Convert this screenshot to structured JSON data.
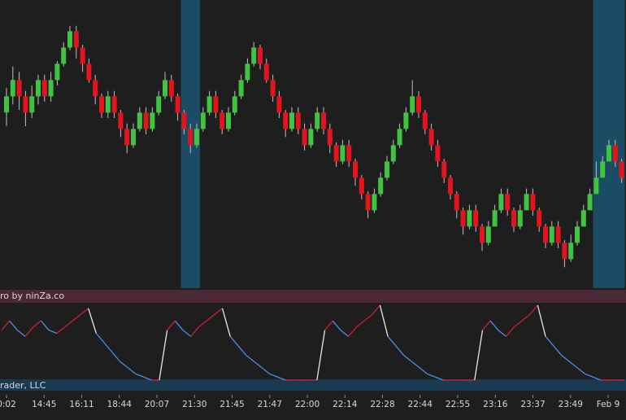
{
  "colors": {
    "background": "#1e1e1e",
    "bull": "#3ec43e",
    "bear": "#e3141b",
    "wick": "#bfbfbf",
    "highlight": "#1a4d63",
    "oscillator_header": "#4a2836",
    "oscillator_footer": "#1a3a52",
    "osc_blue": "#4a8fe8",
    "osc_red": "#d21e32",
    "osc_white": "#e8e8e8",
    "text": "#d8d8d8"
  },
  "price_panel": {
    "highlight_bars": [
      {
        "from_index": 28,
        "to_index": 30
      },
      {
        "from_index": 93,
        "to_index": 97
      }
    ]
  },
  "oscillator_panel": {
    "header_label": "ro by ninZa.co",
    "footer_label": "rader, LLC"
  },
  "chart_data": {
    "type": "candlestick",
    "bar_type": "renko",
    "candles": [
      {
        "o": 135,
        "c": 141,
        "h": 144,
        "l": 130
      },
      {
        "o": 141,
        "c": 147,
        "h": 152,
        "l": 138
      },
      {
        "o": 147,
        "c": 141,
        "h": 150,
        "l": 136
      },
      {
        "o": 141,
        "c": 135,
        "h": 143,
        "l": 130
      },
      {
        "o": 135,
        "c": 141,
        "h": 145,
        "l": 133
      },
      {
        "o": 141,
        "c": 147,
        "h": 149,
        "l": 138
      },
      {
        "o": 147,
        "c": 141,
        "h": 149,
        "l": 139
      },
      {
        "o": 141,
        "c": 147,
        "h": 150,
        "l": 139
      },
      {
        "o": 147,
        "c": 153,
        "h": 154,
        "l": 145
      },
      {
        "o": 153,
        "c": 159,
        "h": 161,
        "l": 152
      },
      {
        "o": 159,
        "c": 165,
        "h": 167,
        "l": 158
      },
      {
        "o": 165,
        "c": 159,
        "h": 167,
        "l": 155
      },
      {
        "o": 159,
        "c": 153,
        "h": 160,
        "l": 150
      },
      {
        "o": 153,
        "c": 147,
        "h": 155,
        "l": 146
      },
      {
        "o": 147,
        "c": 141,
        "h": 149,
        "l": 138
      },
      {
        "o": 141,
        "c": 135,
        "h": 142,
        "l": 133
      },
      {
        "o": 135,
        "c": 141,
        "h": 143,
        "l": 133
      },
      {
        "o": 141,
        "c": 135,
        "h": 143,
        "l": 133
      },
      {
        "o": 135,
        "c": 129,
        "h": 136,
        "l": 126
      },
      {
        "o": 129,
        "c": 123,
        "h": 131,
        "l": 120
      },
      {
        "o": 123,
        "c": 129,
        "h": 131,
        "l": 122
      },
      {
        "o": 129,
        "c": 135,
        "h": 137,
        "l": 128
      },
      {
        "o": 135,
        "c": 129,
        "h": 137,
        "l": 127
      },
      {
        "o": 129,
        "c": 135,
        "h": 137,
        "l": 128
      },
      {
        "o": 135,
        "c": 141,
        "h": 143,
        "l": 134
      },
      {
        "o": 141,
        "c": 147,
        "h": 150,
        "l": 140
      },
      {
        "o": 147,
        "c": 141,
        "h": 149,
        "l": 139
      },
      {
        "o": 141,
        "c": 135,
        "h": 142,
        "l": 132
      },
      {
        "o": 135,
        "c": 129,
        "h": 136,
        "l": 127
      },
      {
        "o": 129,
        "c": 123,
        "h": 131,
        "l": 120
      },
      {
        "o": 123,
        "c": 129,
        "h": 131,
        "l": 122
      },
      {
        "o": 129,
        "c": 135,
        "h": 137,
        "l": 128
      },
      {
        "o": 135,
        "c": 141,
        "h": 143,
        "l": 134
      },
      {
        "o": 141,
        "c": 135,
        "h": 143,
        "l": 133
      },
      {
        "o": 135,
        "c": 129,
        "h": 136,
        "l": 127
      },
      {
        "o": 129,
        "c": 135,
        "h": 137,
        "l": 128
      },
      {
        "o": 135,
        "c": 141,
        "h": 143,
        "l": 134
      },
      {
        "o": 141,
        "c": 147,
        "h": 149,
        "l": 140
      },
      {
        "o": 147,
        "c": 153,
        "h": 155,
        "l": 146
      },
      {
        "o": 153,
        "c": 159,
        "h": 161,
        "l": 152
      },
      {
        "o": 159,
        "c": 153,
        "h": 160,
        "l": 151
      },
      {
        "o": 153,
        "c": 147,
        "h": 155,
        "l": 146
      },
      {
        "o": 147,
        "c": 141,
        "h": 149,
        "l": 139
      },
      {
        "o": 141,
        "c": 135,
        "h": 143,
        "l": 133
      },
      {
        "o": 135,
        "c": 129,
        "h": 136,
        "l": 126
      },
      {
        "o": 129,
        "c": 135,
        "h": 137,
        "l": 128
      },
      {
        "o": 135,
        "c": 129,
        "h": 137,
        "l": 127
      },
      {
        "o": 129,
        "c": 123,
        "h": 131,
        "l": 121
      },
      {
        "o": 123,
        "c": 129,
        "h": 131,
        "l": 122
      },
      {
        "o": 129,
        "c": 135,
        "h": 137,
        "l": 128
      },
      {
        "o": 135,
        "c": 129,
        "h": 137,
        "l": 127
      },
      {
        "o": 129,
        "c": 123,
        "h": 131,
        "l": 120
      },
      {
        "o": 123,
        "c": 117,
        "h": 124,
        "l": 115
      },
      {
        "o": 117,
        "c": 123,
        "h": 125,
        "l": 116
      },
      {
        "o": 123,
        "c": 117,
        "h": 125,
        "l": 115
      },
      {
        "o": 117,
        "c": 111,
        "h": 118,
        "l": 108
      },
      {
        "o": 111,
        "c": 105,
        "h": 112,
        "l": 103
      },
      {
        "o": 105,
        "c": 99,
        "h": 106,
        "l": 96
      },
      {
        "o": 99,
        "c": 105,
        "h": 107,
        "l": 98
      },
      {
        "o": 105,
        "c": 111,
        "h": 113,
        "l": 104
      },
      {
        "o": 111,
        "c": 117,
        "h": 119,
        "l": 110
      },
      {
        "o": 117,
        "c": 123,
        "h": 125,
        "l": 116
      },
      {
        "o": 123,
        "c": 129,
        "h": 131,
        "l": 122
      },
      {
        "o": 129,
        "c": 135,
        "h": 137,
        "l": 128
      },
      {
        "o": 135,
        "c": 141,
        "h": 147,
        "l": 134
      },
      {
        "o": 141,
        "c": 135,
        "h": 143,
        "l": 133
      },
      {
        "o": 135,
        "c": 129,
        "h": 136,
        "l": 127
      },
      {
        "o": 129,
        "c": 123,
        "h": 131,
        "l": 121
      },
      {
        "o": 123,
        "c": 117,
        "h": 125,
        "l": 115
      },
      {
        "o": 117,
        "c": 111,
        "h": 118,
        "l": 109
      },
      {
        "o": 111,
        "c": 105,
        "h": 112,
        "l": 103
      },
      {
        "o": 105,
        "c": 99,
        "h": 106,
        "l": 96
      },
      {
        "o": 99,
        "c": 93,
        "h": 100,
        "l": 90
      },
      {
        "o": 93,
        "c": 99,
        "h": 101,
        "l": 92
      },
      {
        "o": 99,
        "c": 93,
        "h": 101,
        "l": 91
      },
      {
        "o": 93,
        "c": 87,
        "h": 94,
        "l": 84
      },
      {
        "o": 87,
        "c": 93,
        "h": 95,
        "l": 86
      },
      {
        "o": 93,
        "c": 99,
        "h": 101,
        "l": 98
      },
      {
        "o": 99,
        "c": 105,
        "h": 107,
        "l": 98
      },
      {
        "o": 105,
        "c": 99,
        "h": 107,
        "l": 97
      },
      {
        "o": 99,
        "c": 93,
        "h": 100,
        "l": 91
      },
      {
        "o": 93,
        "c": 99,
        "h": 101,
        "l": 92
      },
      {
        "o": 99,
        "c": 105,
        "h": 107,
        "l": 104
      },
      {
        "o": 105,
        "c": 99,
        "h": 107,
        "l": 97
      },
      {
        "o": 99,
        "c": 93,
        "h": 100,
        "l": 91
      },
      {
        "o": 93,
        "c": 87,
        "h": 94,
        "l": 85
      },
      {
        "o": 87,
        "c": 93,
        "h": 95,
        "l": 86
      },
      {
        "o": 93,
        "c": 87,
        "h": 95,
        "l": 85
      },
      {
        "o": 87,
        "c": 81,
        "h": 88,
        "l": 78
      },
      {
        "o": 81,
        "c": 87,
        "h": 90,
        "l": 80
      },
      {
        "o": 87,
        "c": 93,
        "h": 95,
        "l": 86
      },
      {
        "o": 93,
        "c": 99,
        "h": 101,
        "l": 98
      },
      {
        "o": 99,
        "c": 105,
        "h": 107,
        "l": 104
      },
      {
        "o": 105,
        "c": 111,
        "h": 117,
        "l": 110
      },
      {
        "o": 111,
        "c": 117,
        "h": 119,
        "l": 116
      },
      {
        "o": 117,
        "c": 123,
        "h": 125,
        "l": 122
      },
      {
        "o": 123,
        "c": 117,
        "h": 125,
        "l": 115
      },
      {
        "o": 117,
        "c": 111,
        "h": 118,
        "l": 109
      }
    ],
    "oscillator": {
      "values": [
        60,
        66,
        60,
        56,
        62,
        66,
        60,
        58,
        62,
        66,
        70,
        74,
        58,
        52,
        46,
        40,
        36,
        32,
        30,
        28,
        28,
        60,
        66,
        60,
        56,
        62,
        66,
        70,
        74,
        56,
        50,
        44,
        40,
        36,
        32,
        30,
        28,
        28,
        28,
        28,
        28,
        60,
        66,
        60,
        56,
        62,
        66,
        70,
        76,
        56,
        50,
        44,
        40,
        36,
        32,
        30,
        28,
        28,
        28,
        28,
        28,
        60,
        66,
        60,
        56,
        62,
        66,
        70,
        76,
        56,
        50,
        44,
        40,
        36,
        32,
        30,
        28,
        28,
        28,
        28
      ]
    },
    "x_tick_labels": [
      "0:02",
      "14:45",
      "16:11",
      "18:44",
      "20:07",
      "21:30",
      "21:45",
      "21:47",
      "22:00",
      "22:14",
      "22:28",
      "22:44",
      "22:55",
      "23:16",
      "23:37",
      "23:49",
      "Feb 9"
    ]
  }
}
